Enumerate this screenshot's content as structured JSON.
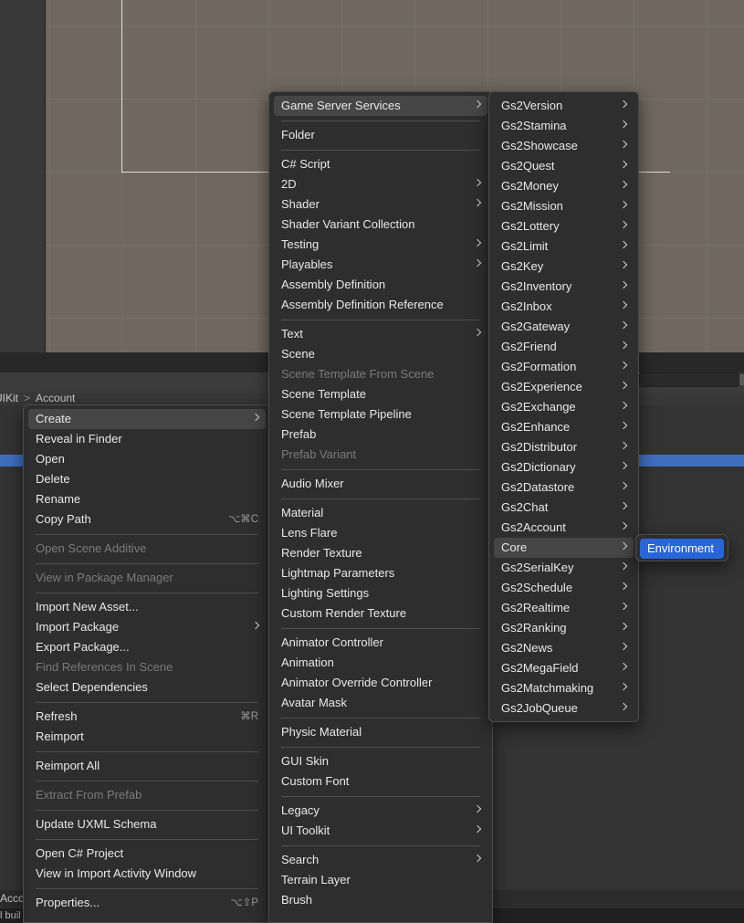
{
  "breadcrumb": {
    "parent": "UIKit",
    "separator": ">",
    "current": "Account"
  },
  "bottom": {
    "left_label": "Acco",
    "status": "l buil"
  },
  "colors": {
    "accent": "#2866d8",
    "selection_row": "#3f6ebd",
    "menu_bg": "#2e2e2e",
    "scene_bg": "#70685f"
  },
  "asset_menu": {
    "items": [
      {
        "type": "item",
        "label": "Create",
        "arrow": true,
        "state": "hover"
      },
      {
        "type": "item",
        "label": "Reveal in Finder"
      },
      {
        "type": "item",
        "label": "Open"
      },
      {
        "type": "item",
        "label": "Delete"
      },
      {
        "type": "item",
        "label": "Rename"
      },
      {
        "type": "item",
        "label": "Copy Path",
        "shortcut": "⌥⌘C"
      },
      {
        "type": "sep"
      },
      {
        "type": "item",
        "label": "Open Scene Additive",
        "disabled": true
      },
      {
        "type": "sep"
      },
      {
        "type": "item",
        "label": "View in Package Manager",
        "disabled": true
      },
      {
        "type": "sep"
      },
      {
        "type": "item",
        "label": "Import New Asset..."
      },
      {
        "type": "item",
        "label": "Import Package",
        "arrow": true
      },
      {
        "type": "item",
        "label": "Export Package..."
      },
      {
        "type": "item",
        "label": "Find References In Scene",
        "disabled": true
      },
      {
        "type": "item",
        "label": "Select Dependencies"
      },
      {
        "type": "sep"
      },
      {
        "type": "item",
        "label": "Refresh",
        "shortcut": "⌘R"
      },
      {
        "type": "item",
        "label": "Reimport"
      },
      {
        "type": "sep"
      },
      {
        "type": "item",
        "label": "Reimport All"
      },
      {
        "type": "sep"
      },
      {
        "type": "item",
        "label": "Extract From Prefab",
        "disabled": true
      },
      {
        "type": "sep"
      },
      {
        "type": "item",
        "label": "Update UXML Schema"
      },
      {
        "type": "sep"
      },
      {
        "type": "item",
        "label": "Open C# Project"
      },
      {
        "type": "item",
        "label": "View in Import Activity Window"
      },
      {
        "type": "sep"
      },
      {
        "type": "item",
        "label": "Properties...",
        "shortcut": "⌥⇧P"
      }
    ]
  },
  "create_menu": {
    "items": [
      {
        "type": "item",
        "label": "Game Server Services",
        "arrow": true,
        "state": "hover"
      },
      {
        "type": "sep"
      },
      {
        "type": "item",
        "label": "Folder"
      },
      {
        "type": "sep"
      },
      {
        "type": "item",
        "label": "C# Script"
      },
      {
        "type": "item",
        "label": "2D",
        "arrow": true
      },
      {
        "type": "item",
        "label": "Shader",
        "arrow": true
      },
      {
        "type": "item",
        "label": "Shader Variant Collection"
      },
      {
        "type": "item",
        "label": "Testing",
        "arrow": true
      },
      {
        "type": "item",
        "label": "Playables",
        "arrow": true
      },
      {
        "type": "item",
        "label": "Assembly Definition"
      },
      {
        "type": "item",
        "label": "Assembly Definition Reference"
      },
      {
        "type": "sep"
      },
      {
        "type": "item",
        "label": "Text",
        "arrow": true
      },
      {
        "type": "item",
        "label": "Scene"
      },
      {
        "type": "item",
        "label": "Scene Template From Scene",
        "disabled": true
      },
      {
        "type": "item",
        "label": "Scene Template"
      },
      {
        "type": "item",
        "label": "Scene Template Pipeline"
      },
      {
        "type": "item",
        "label": "Prefab"
      },
      {
        "type": "item",
        "label": "Prefab Variant",
        "disabled": true
      },
      {
        "type": "sep"
      },
      {
        "type": "item",
        "label": "Audio Mixer"
      },
      {
        "type": "sep"
      },
      {
        "type": "item",
        "label": "Material"
      },
      {
        "type": "item",
        "label": "Lens Flare"
      },
      {
        "type": "item",
        "label": "Render Texture"
      },
      {
        "type": "item",
        "label": "Lightmap Parameters"
      },
      {
        "type": "item",
        "label": "Lighting Settings"
      },
      {
        "type": "item",
        "label": "Custom Render Texture"
      },
      {
        "type": "sep"
      },
      {
        "type": "item",
        "label": "Animator Controller"
      },
      {
        "type": "item",
        "label": "Animation"
      },
      {
        "type": "item",
        "label": "Animator Override Controller"
      },
      {
        "type": "item",
        "label": "Avatar Mask"
      },
      {
        "type": "sep"
      },
      {
        "type": "item",
        "label": "Physic Material"
      },
      {
        "type": "sep"
      },
      {
        "type": "item",
        "label": "GUI Skin"
      },
      {
        "type": "item",
        "label": "Custom Font"
      },
      {
        "type": "sep"
      },
      {
        "type": "item",
        "label": "Legacy",
        "arrow": true
      },
      {
        "type": "item",
        "label": "UI Toolkit",
        "arrow": true
      },
      {
        "type": "sep"
      },
      {
        "type": "item",
        "label": "Search",
        "arrow": true
      },
      {
        "type": "item",
        "label": "Terrain Layer"
      },
      {
        "type": "item",
        "label": "Brush"
      }
    ]
  },
  "gs2_menu": {
    "items": [
      {
        "type": "item",
        "label": "Gs2Version",
        "arrow": true
      },
      {
        "type": "item",
        "label": "Gs2Stamina",
        "arrow": true
      },
      {
        "type": "item",
        "label": "Gs2Showcase",
        "arrow": true
      },
      {
        "type": "item",
        "label": "Gs2Quest",
        "arrow": true
      },
      {
        "type": "item",
        "label": "Gs2Money",
        "arrow": true
      },
      {
        "type": "item",
        "label": "Gs2Mission",
        "arrow": true
      },
      {
        "type": "item",
        "label": "Gs2Lottery",
        "arrow": true
      },
      {
        "type": "item",
        "label": "Gs2Limit",
        "arrow": true
      },
      {
        "type": "item",
        "label": "Gs2Key",
        "arrow": true
      },
      {
        "type": "item",
        "label": "Gs2Inventory",
        "arrow": true
      },
      {
        "type": "item",
        "label": "Gs2Inbox",
        "arrow": true
      },
      {
        "type": "item",
        "label": "Gs2Gateway",
        "arrow": true
      },
      {
        "type": "item",
        "label": "Gs2Friend",
        "arrow": true
      },
      {
        "type": "item",
        "label": "Gs2Formation",
        "arrow": true
      },
      {
        "type": "item",
        "label": "Gs2Experience",
        "arrow": true
      },
      {
        "type": "item",
        "label": "Gs2Exchange",
        "arrow": true
      },
      {
        "type": "item",
        "label": "Gs2Enhance",
        "arrow": true
      },
      {
        "type": "item",
        "label": "Gs2Distributor",
        "arrow": true
      },
      {
        "type": "item",
        "label": "Gs2Dictionary",
        "arrow": true
      },
      {
        "type": "item",
        "label": "Gs2Datastore",
        "arrow": true
      },
      {
        "type": "item",
        "label": "Gs2Chat",
        "arrow": true
      },
      {
        "type": "item",
        "label": "Gs2Account",
        "arrow": true
      },
      {
        "type": "item",
        "label": "Core",
        "arrow": true,
        "state": "hover"
      },
      {
        "type": "item",
        "label": "Gs2SerialKey",
        "arrow": true
      },
      {
        "type": "item",
        "label": "Gs2Schedule",
        "arrow": true
      },
      {
        "type": "item",
        "label": "Gs2Realtime",
        "arrow": true
      },
      {
        "type": "item",
        "label": "Gs2Ranking",
        "arrow": true
      },
      {
        "type": "item",
        "label": "Gs2News",
        "arrow": true
      },
      {
        "type": "item",
        "label": "Gs2MegaField",
        "arrow": true
      },
      {
        "type": "item",
        "label": "Gs2Matchmaking",
        "arrow": true
      },
      {
        "type": "item",
        "label": "Gs2JobQueue",
        "arrow": true
      }
    ]
  },
  "core_menu": {
    "items": [
      {
        "type": "item",
        "label": "Environment",
        "state": "active"
      }
    ]
  }
}
